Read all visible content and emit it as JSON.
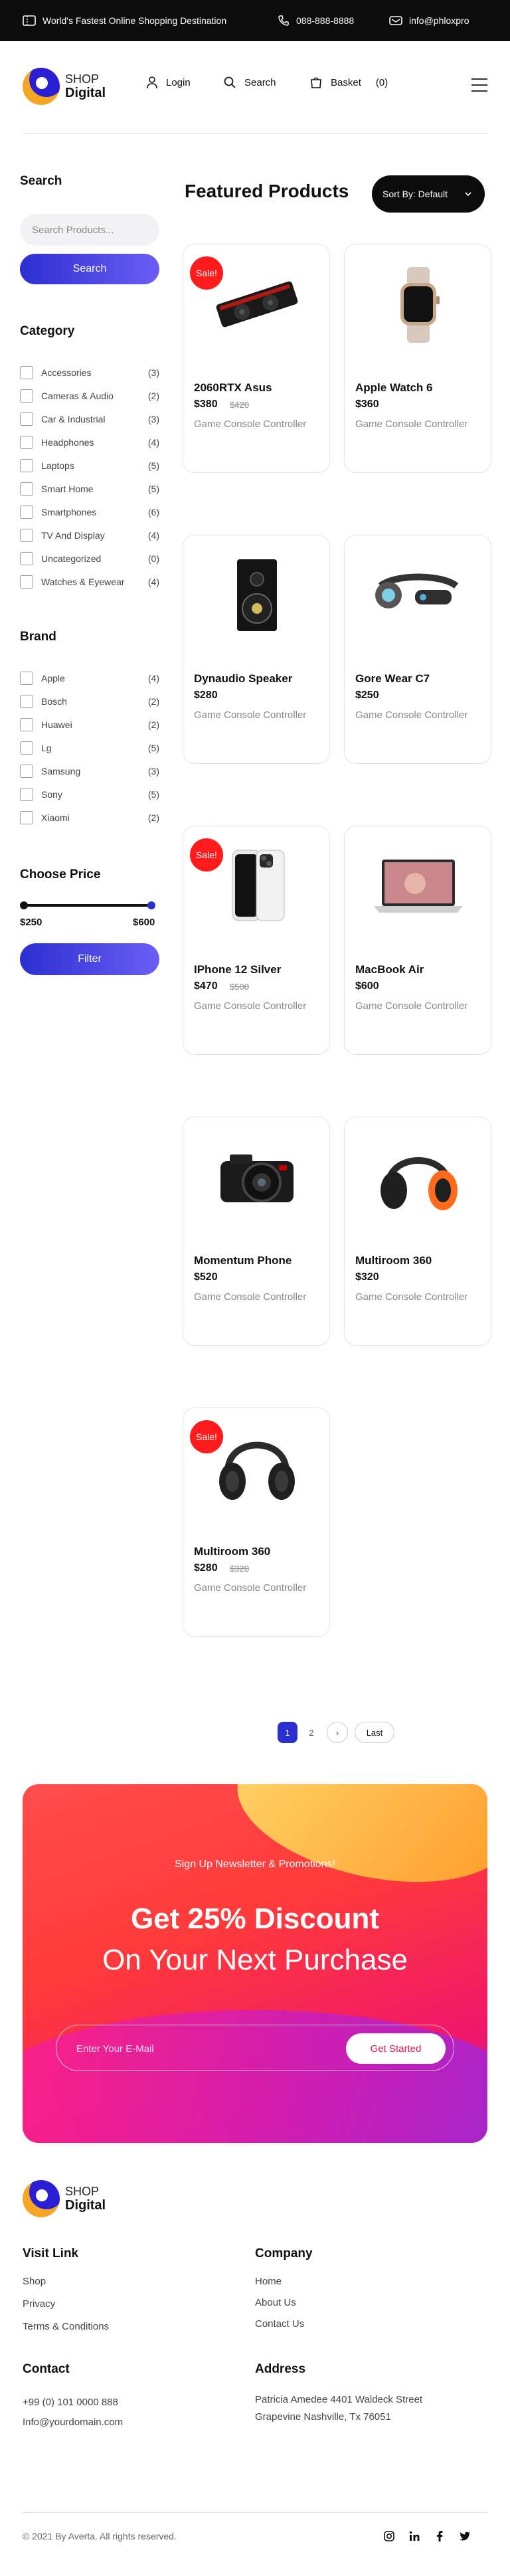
{
  "topbar": {
    "tagline": "World's Fastest Online Shopping Destination",
    "phone": "088-888-8888",
    "email": "info@phloxpro"
  },
  "logo": {
    "line1": "SHOP",
    "line2": "Digital"
  },
  "header_nav": {
    "login": "Login",
    "search": "Search",
    "basket": "Basket",
    "basket_count": "(0)"
  },
  "sidebar": {
    "search_title": "Search",
    "search_placeholder": "Search Products...",
    "search_button": "Search",
    "category_title": "Category",
    "categories": [
      {
        "label": "Accessories",
        "count": "(3)"
      },
      {
        "label": "Cameras & Audio",
        "count": "(2)"
      },
      {
        "label": "Car & Industrial",
        "count": "(3)"
      },
      {
        "label": "Headphones",
        "count": "(4)"
      },
      {
        "label": "Laptops",
        "count": "(5)"
      },
      {
        "label": "Smart Home",
        "count": "(5)"
      },
      {
        "label": "Smartphones",
        "count": "(6)"
      },
      {
        "label": "TV And Display",
        "count": "(4)"
      },
      {
        "label": "Uncategorized",
        "count": "(0)"
      },
      {
        "label": "Watches & Eyewear",
        "count": "(4)"
      }
    ],
    "brand_title": "Brand",
    "brands": [
      {
        "label": "Apple",
        "count": "(4)"
      },
      {
        "label": "Bosch",
        "count": "(2)"
      },
      {
        "label": "Huawei",
        "count": "(2)"
      },
      {
        "label": "Lg",
        "count": "(5)"
      },
      {
        "label": "Samsung",
        "count": "(3)"
      },
      {
        "label": "Sony",
        "count": "(5)"
      },
      {
        "label": "Xiaomi",
        "count": "(2)"
      }
    ],
    "price_title": "Choose Price",
    "price_min": "$250",
    "price_max": "$600",
    "filter_button": "Filter"
  },
  "main": {
    "title": "Featured Products",
    "sort_label": "Sort By: Default",
    "sale_label": "Sale!",
    "products": [
      {
        "name": "2060RTX Asus",
        "price": "$380",
        "old_price": "$420",
        "desc": "Game Console Controller",
        "sale": true,
        "image": "graphics-card"
      },
      {
        "name": "Apple Watch 6",
        "price": "$360",
        "old_price": "",
        "desc": "Game Console Controller",
        "sale": false,
        "image": "smartwatch"
      },
      {
        "name": "Dynaudio Speaker",
        "price": "$280",
        "old_price": "",
        "desc": "Game Console Controller",
        "sale": false,
        "image": "speaker"
      },
      {
        "name": "Gore Wear C7",
        "price": "$250",
        "old_price": "",
        "desc": "Game Console Controller",
        "sale": false,
        "image": "earbud"
      },
      {
        "name": "IPhone 12 Silver",
        "price": "$470",
        "old_price": "$500",
        "desc": "Game Console Controller",
        "sale": true,
        "image": "phone"
      },
      {
        "name": "MacBook Air",
        "price": "$600",
        "old_price": "",
        "desc": "Game Console Controller",
        "sale": false,
        "image": "laptop"
      },
      {
        "name": "Momentum Phone",
        "price": "$520",
        "old_price": "",
        "desc": "Game Console Controller",
        "sale": false,
        "image": "camera"
      },
      {
        "name": "Multiroom 360",
        "price": "$320",
        "old_price": "",
        "desc": "Game Console Controller",
        "sale": false,
        "image": "headphones-orange"
      },
      {
        "name": "Multiroom 360",
        "price": "$280",
        "old_price": "$320",
        "desc": "Game Console Controller",
        "sale": true,
        "image": "headphones-black"
      }
    ],
    "pagination": {
      "page1": "1",
      "page2": "2",
      "next": "›",
      "last": "Last"
    }
  },
  "newsletter": {
    "subtitle": "Sign Up Newsletter & Promotions!",
    "headline1": "Get 25% Discount",
    "headline2": "On Your Next Purchase",
    "email_placeholder": "Enter Your E-Mail",
    "button": "Get Started"
  },
  "footer": {
    "logo_line1": "SHOP",
    "logo_line2": "Digital",
    "visit_title": "Visit Link",
    "visit_links": [
      "Shop",
      "Privacy",
      "Terms & Conditions"
    ],
    "company_title": "Company",
    "company_links": [
      "Home",
      "About Us",
      "Contact Us"
    ],
    "contact_title": "Contact",
    "contact_phone": "+99 (0) 101 0000 888",
    "contact_email": "Info@yourdomain.com",
    "address_title": "Address",
    "address_line1": "Patricia Amedee 4401 Waldeck Street",
    "address_line2": "Grapevine Nashville, Tx 76051",
    "copyright": "© 2021 By Averta. All rights reserved.",
    "social": [
      "instagram-icon",
      "linkedin-icon",
      "facebook-icon",
      "twitter-icon"
    ]
  },
  "colors": {
    "accent": "#2c2fd0",
    "sale": "#ff1b1b",
    "dark": "#0c0c0c"
  }
}
